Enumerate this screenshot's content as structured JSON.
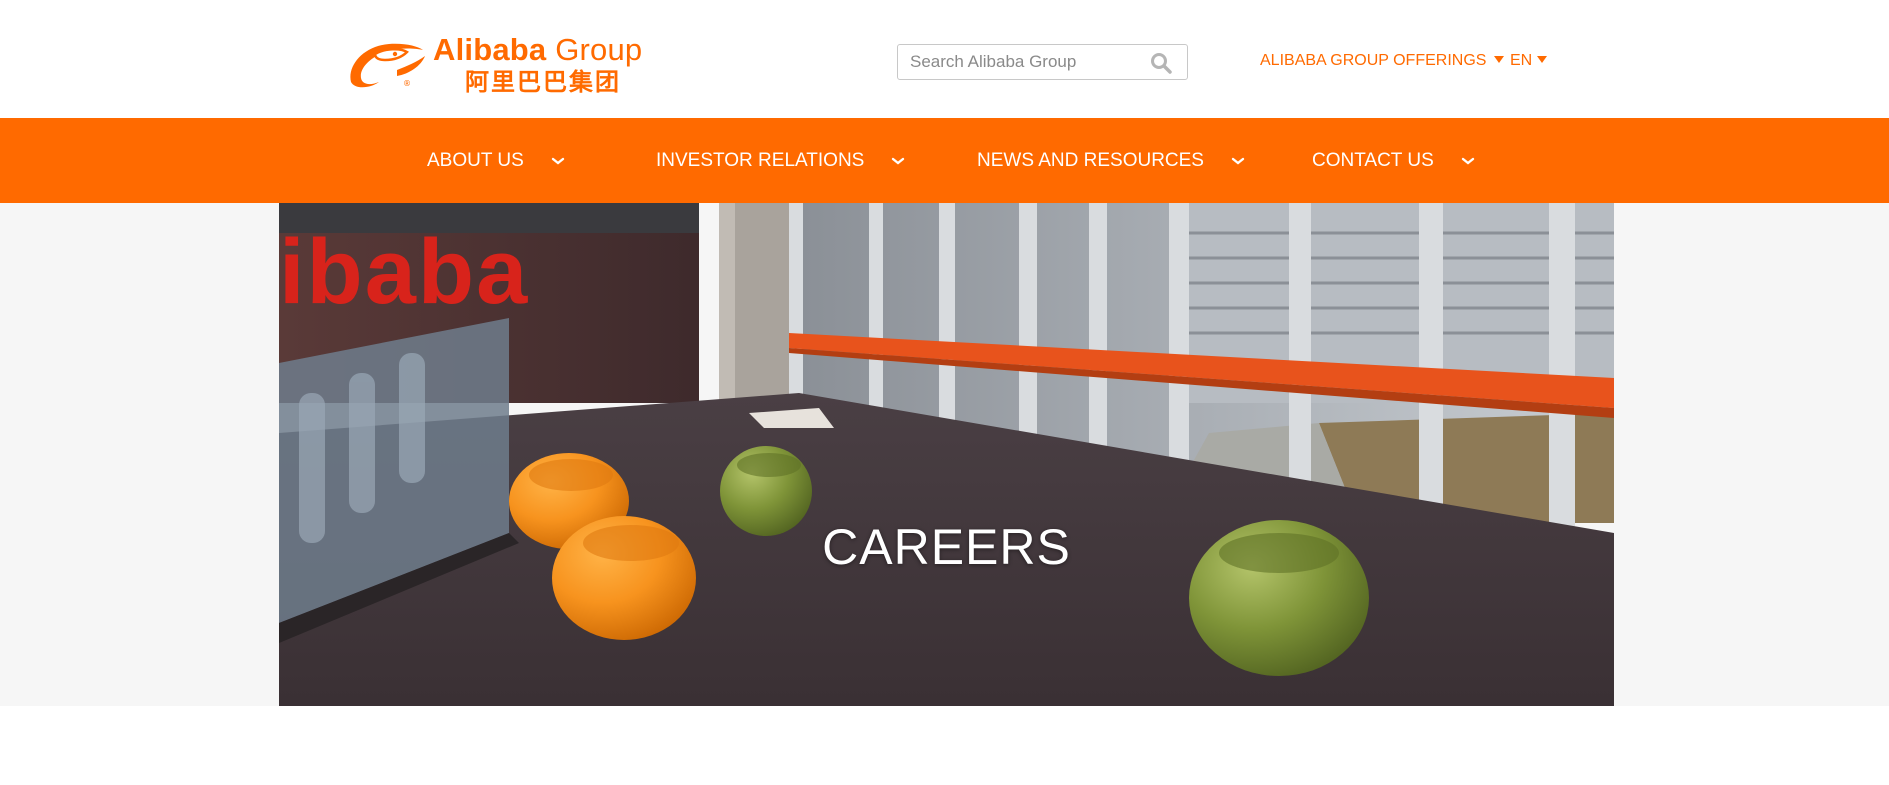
{
  "header": {
    "logo_text_main": "Alibaba",
    "logo_text_group": " Group",
    "logo_text_cn": "阿里巴巴集团",
    "search": {
      "placeholder": "Search Alibaba Group",
      "value": ""
    },
    "offerings_label": "ALIBABA GROUP OFFERINGS",
    "language_label": "EN"
  },
  "nav": {
    "items": [
      {
        "label": "ABOUT US"
      },
      {
        "label": "INVESTOR RELATIONS"
      },
      {
        "label": "NEWS AND RESOURCES"
      },
      {
        "label": "CONTACT US"
      }
    ]
  },
  "hero": {
    "title": "CAREERS",
    "wall_text": "ibaba"
  },
  "colors": {
    "brand_orange": "#ff6a00",
    "hero_band": "#f6f6f6",
    "white": "#ffffff"
  },
  "icons": {
    "search": "search-icon",
    "dropdown": "caret-down-icon",
    "nav_chevron": "chevron-down-icon"
  }
}
